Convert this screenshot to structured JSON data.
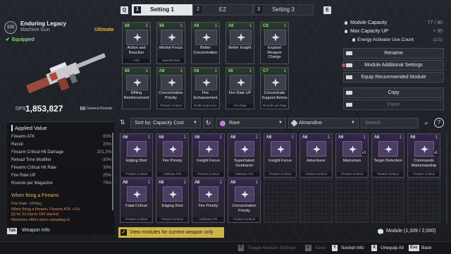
{
  "top_tabs": {
    "left_key": "Q",
    "right_key": "E",
    "tabs": [
      {
        "num": "1",
        "label": "Setting 1",
        "active": true
      },
      {
        "num": "2",
        "label": "EZ",
        "active": false
      },
      {
        "num": "3",
        "label": "Setting 3",
        "active": false
      }
    ]
  },
  "weapon": {
    "level": "100",
    "name": "Enduring Legacy",
    "type": "Machine Gun",
    "tier": "Ultimate",
    "equipped_label": "Equipped",
    "dps_label": "DPS",
    "dps_value": "1,853,827",
    "ammo_type": "General Rounds"
  },
  "applied": {
    "header": "Applied Value",
    "stats": [
      {
        "name": "Firearm ATK",
        "value": "93%"
      },
      {
        "name": "Recoil",
        "value": "20%"
      },
      {
        "name": "Firearm Critical Hit Damage",
        "value": "201.3%"
      },
      {
        "name": "Reload Time Modifier",
        "value": "-30%"
      },
      {
        "name": "Firearm Critical Hit Rate",
        "value": "39%"
      },
      {
        "name": "Fire Rate UP",
        "value": "25%"
      },
      {
        "name": "Rounds per Magazine",
        "value": "79%"
      }
    ],
    "when_label": "When firing a Firearm",
    "desc_lines": [
      "Fire Rate -10%[x].",
      "When firing a firearm, Firearm ATK +1%",
      "[x] for 2s (Up to 150 stacks)",
      "Removes effect when reloading or"
    ]
  },
  "weapon_info": {
    "key": "Tab",
    "label": "Weapon Info"
  },
  "equipped_slots": [
    {
      "cap": "¥8",
      "sock": "1",
      "name": "Action and Reaction",
      "sub": "ATK"
    },
    {
      "cap": "¥8",
      "sock": "1",
      "name": "Mental Focus",
      "sub": "Special Mod"
    },
    {
      "cap": "Λ8",
      "sock": "1",
      "name": "Better Concentration",
      "sub": ""
    },
    {
      "cap": "Λ8",
      "sock": "1",
      "name": "Better Insight",
      "sub": ""
    },
    {
      "cap": "C8",
      "sock": "1",
      "name": "Expand Weapon Charge",
      "sub": ""
    },
    {
      "cap": "¥8",
      "sock": "1",
      "name": "Rifling Reinforcement",
      "sub": ""
    },
    {
      "cap": "Λ8",
      "sock": "1",
      "name": "Concentration Priority",
      "sub": "Firearm Critical"
    },
    {
      "cap": "Λ8",
      "sock": "1",
      "name": "Fire Enhancement",
      "sub": "Bullet Improvem"
    },
    {
      "cap": "¥6",
      "sock": "1",
      "name": "Fire Rate UP",
      "sub": "Fire Rate"
    },
    {
      "cap": "C7",
      "sock": "1",
      "name": "Concentrate Support Ammo",
      "sub": "Rounds per Mag"
    }
  ],
  "side_panel": {
    "capacity_label": "Module Capacity",
    "capacity_value": "77 / 80",
    "capacity_up_label": "Max Capacity UP",
    "capacity_up_value": "+ 30",
    "activator_label": "Energy Activator Use Count",
    "activator_value": "(1/1)",
    "buttons": [
      "Rename",
      "Module Additional Settings",
      "Equip Recommended Module",
      "Copy",
      "Paste"
    ]
  },
  "filters": {
    "sort_label": "Sort by: Capacity Cost",
    "rarity_label": "Rare",
    "element_label": "Almandine",
    "search_placeholder": "Search"
  },
  "inventory": [
    {
      "cap": "Λ6",
      "sock": "1",
      "name": "Edging Shot",
      "sub": "Firearm Critical",
      "stack": ""
    },
    {
      "cap": "Λ6",
      "sock": "1",
      "name": "Fire Priority",
      "sub": "Attribute ATK",
      "stack": ""
    },
    {
      "cap": "Λ6",
      "sock": "1",
      "name": "Insight Focus",
      "sub": "Firearm Critical",
      "stack": ""
    },
    {
      "cap": "Λ6",
      "sock": "1",
      "name": "Superhated Gunbarrel",
      "sub": "Attribute ATK",
      "stack": ""
    },
    {
      "cap": "Λ6",
      "sock": "1",
      "name": "Insight Focus",
      "sub": "Firearm Critical",
      "stack": ""
    },
    {
      "cap": "Λ6",
      "sock": "1",
      "name": "Adventurer",
      "sub": "Firearm Critical",
      "stack": ""
    },
    {
      "cap": "Λ6",
      "sock": "1",
      "name": "Marksman",
      "sub": "Firearm Critical",
      "stack": "x3"
    },
    {
      "cap": "Λ6",
      "sock": "1",
      "name": "Target Detection",
      "sub": "Firearm Critical",
      "stack": ""
    },
    {
      "cap": "Λ6",
      "sock": "1",
      "name": "Commando Marksmanship",
      "sub": "Firearm Critical",
      "stack": "x6"
    },
    {
      "cap": "Λ6",
      "sock": "1",
      "name": "Fatal Critical",
      "sub": "Firearm Critical",
      "stack": ""
    },
    {
      "cap": "Λ6",
      "sock": "1",
      "name": "Edging Shot",
      "sub": "Firearm Critical",
      "stack": ""
    },
    {
      "cap": "Λ6",
      "sock": "1",
      "name": "Fire Priority",
      "sub": "Attribute ATK",
      "stack": ""
    },
    {
      "cap": "Λ6",
      "sock": "1",
      "name": "Concentration Priority",
      "sub": "Firearm Critical",
      "stack": ""
    }
  ],
  "bottom": {
    "checkbox_label": "View modules for current weapon only",
    "module_count": "Module (1,339 / 2,000)"
  },
  "footer": [
    {
      "key": "R",
      "label": "Trigger Module Settings",
      "on": false
    },
    {
      "key": "↵",
      "label": "Save",
      "on": false
    },
    {
      "key": "Y",
      "label": "Socket Info",
      "on": true
    },
    {
      "key": "X",
      "label": "Unequip All",
      "on": true
    },
    {
      "key": "Esc",
      "label": "Back",
      "on": true
    }
  ]
}
